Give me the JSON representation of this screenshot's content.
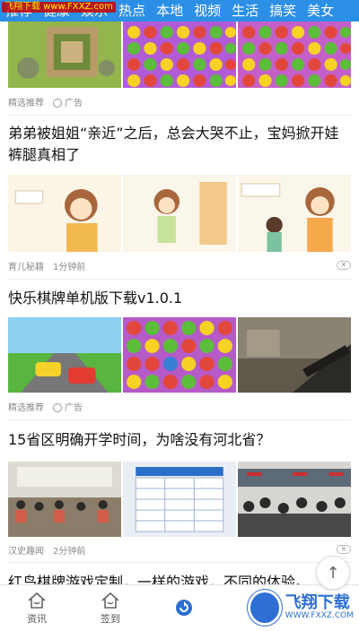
{
  "watermark": "飞翔下载 www.FXXZ.com",
  "tabs": [
    "推荐",
    "健康",
    "娱乐",
    "热点",
    "本地",
    "视频",
    "生活",
    "搞笑",
    "美女"
  ],
  "feed": [
    {
      "kind": "images-only",
      "meta_source": "精选推荐",
      "meta_tag": "广告"
    },
    {
      "kind": "article",
      "title": "弟弟被姐姐“亲近”之后，总会大哭不止，宝妈掀开娃裤腿真相了",
      "meta_source": "育儿秘籍",
      "meta_time": "1分钟前",
      "dismiss": "✕"
    },
    {
      "kind": "ad",
      "title": "快乐棋牌单机版下载v1.0.1",
      "meta_source": "精选推荐",
      "meta_tag": "广告"
    },
    {
      "kind": "article",
      "title": "15省区明确开学时间，为啥没有河北省？",
      "meta_source": "汉史趣闻",
      "meta_time": "2分钟前",
      "dismiss": "✕"
    },
    {
      "kind": "ad",
      "title": "红鸟棋牌游戏定制，一样的游戏，不同的体验。"
    }
  ],
  "bottom_nav": [
    {
      "label": "资讯",
      "icon": "home-icon"
    },
    {
      "label": "签到",
      "icon": "home-icon"
    },
    {
      "label": "",
      "icon": "refresh-icon"
    }
  ],
  "brand": {
    "name": "飞翔下载",
    "url": "WWW.FXXZ.COM"
  },
  "totop_label": "↑",
  "colors": {
    "accent": "#2b8fe6",
    "brand": "#2f6fd3"
  }
}
